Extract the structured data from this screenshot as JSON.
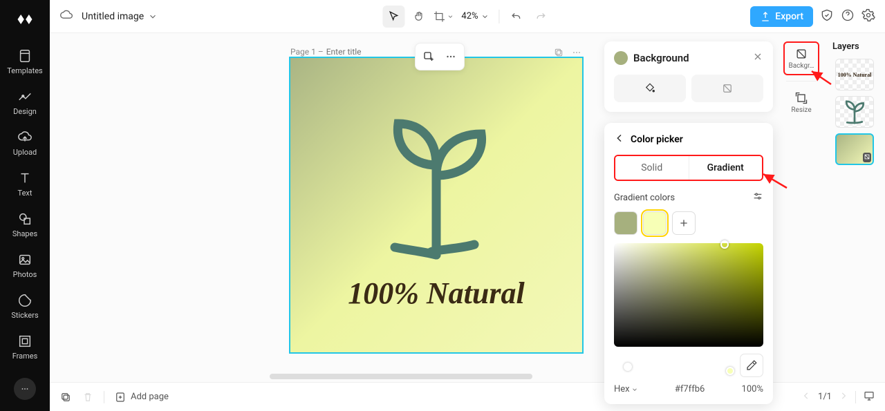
{
  "app": {
    "document_title": "Untitled image"
  },
  "left_nav": {
    "items": [
      {
        "label": "Templates"
      },
      {
        "label": "Design"
      },
      {
        "label": "Upload"
      },
      {
        "label": "Text"
      },
      {
        "label": "Shapes"
      },
      {
        "label": "Photos"
      },
      {
        "label": "Stickers"
      },
      {
        "label": "Frames"
      }
    ]
  },
  "top": {
    "zoom": "42%",
    "export_label": "Export"
  },
  "page": {
    "label_prefix": "Page 1 –",
    "title_placeholder": "Enter title",
    "artwork_text": "100% Natural"
  },
  "bg_panel": {
    "title": "Background"
  },
  "color_picker": {
    "title": "Color picker",
    "tab_solid": "Solid",
    "tab_gradient": "Gradient",
    "section_label": "Gradient colors",
    "swatches": [
      "#a6b07e",
      "#f7ffb6"
    ],
    "hex_label": "Hex",
    "hex_value": "#f7ffb6",
    "opacity": "100%"
  },
  "right_rail": {
    "background": "Backgr…",
    "resize": "Resize"
  },
  "layers": {
    "title": "Layers",
    "thumb_text_label": "100% Natural"
  },
  "bottom": {
    "add_page": "Add page",
    "page_indicator": "1/1"
  }
}
